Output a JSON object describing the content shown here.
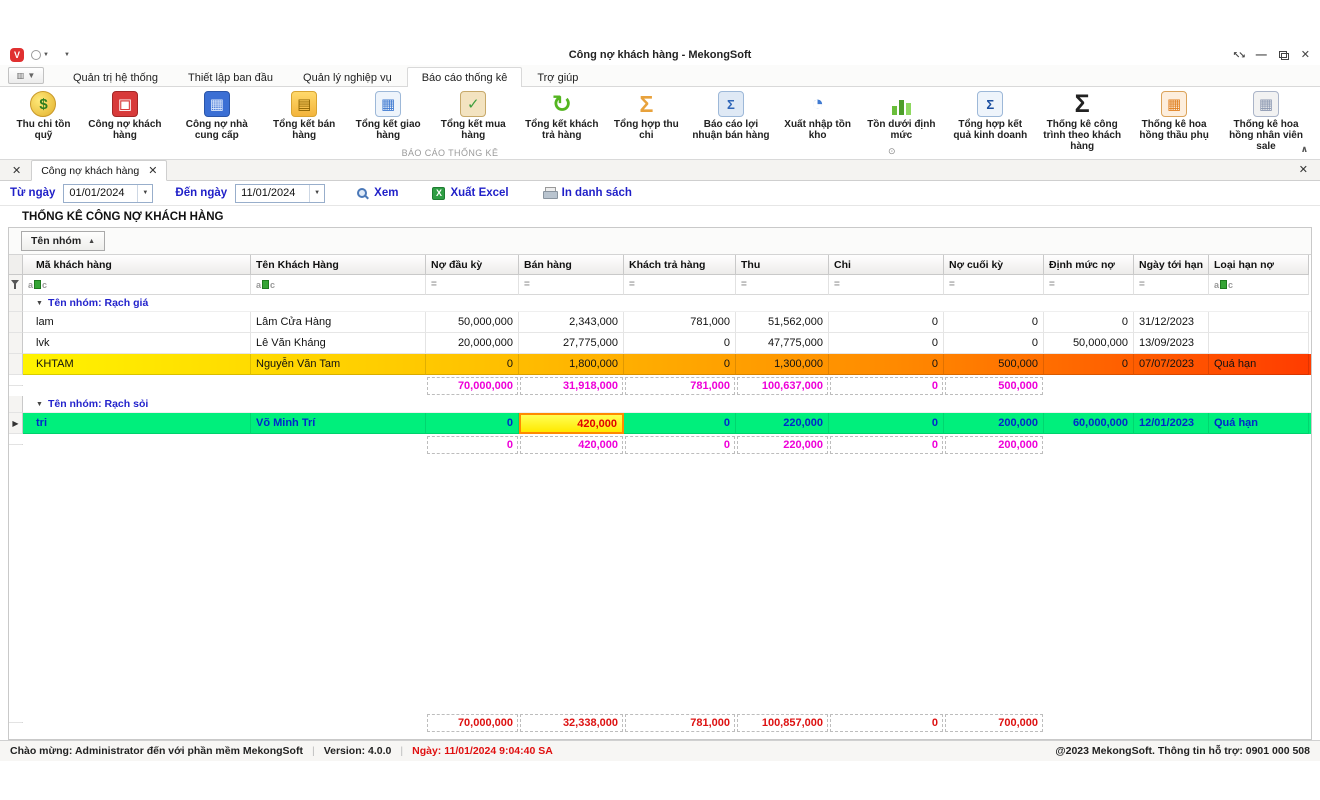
{
  "window": {
    "title": "Công nợ khách hàng - MekongSoft",
    "app_logo": "mekongsoft-logo-icon",
    "controls": [
      "expand-icon",
      "minimize-icon",
      "restore-icon",
      "close-icon"
    ]
  },
  "ribbon": {
    "tabs": [
      "Quản trị hệ thống",
      "Thiết lập ban đầu",
      "Quản lý nghiệp vụ",
      "Báo cáo thống kê",
      "Trợ giúp"
    ],
    "active_tab_index": 3,
    "group_label": "BÁO CÁO THỐNG KÊ",
    "buttons": [
      {
        "label": "Thu chi tồn quỹ",
        "icon": "coins-icon"
      },
      {
        "label": "Công nợ khách hàng",
        "icon": "customer-debt-icon"
      },
      {
        "label": "Công nợ nhà cung cấp",
        "icon": "supplier-debt-icon"
      },
      {
        "label": "Tổng kết bán hàng",
        "icon": "sales-note-icon"
      },
      {
        "label": "Tổng kết giao hàng",
        "icon": "delivery-table-icon"
      },
      {
        "label": "Tổng kết mua hàng",
        "icon": "purchase-clipboard-icon"
      },
      {
        "label": "Tổng kết khách trả hàng",
        "icon": "returns-refresh-icon"
      },
      {
        "label": "Tổng hợp thu chi",
        "icon": "sigma-orange-icon"
      },
      {
        "label": "Báo cáo lợi nhuận bán hàng",
        "icon": "profit-table-icon"
      },
      {
        "label": "Xuất nhập tồn kho",
        "icon": "inventory-gauge-icon"
      },
      {
        "label": "Tồn dưới định mức",
        "icon": "stock-bars-icon"
      },
      {
        "label": "Tổng hợp kết quả kinh doanh",
        "icon": "business-result-icon"
      },
      {
        "label": "Thống kê công trình theo khách hàng",
        "icon": "sigma-black-icon"
      },
      {
        "label": "Thống kê hoa hồng thầu phụ",
        "icon": "commission-table-icon"
      },
      {
        "label": "Thống kê hoa hồng nhân viên sale",
        "icon": "sales-grid-icon"
      }
    ]
  },
  "doc_tab": {
    "label": "Công nợ khách hàng"
  },
  "filter_bar": {
    "from_label": "Từ ngày",
    "from_value": "01/01/2024",
    "to_label": "Đến ngày",
    "to_value": "11/01/2024",
    "view_button": "Xem",
    "view_icon": "magnifier-icon",
    "excel_button": "Xuất Excel",
    "excel_icon": "excel-icon",
    "print_button": "In danh sách",
    "print_icon": "printer-icon"
  },
  "report_title": "THỐNG KÊ CÔNG NỢ KHÁCH HÀNG",
  "group_panel": {
    "label": "Tên nhóm",
    "sort": "ascending"
  },
  "grid": {
    "columns": [
      "Mã khách hàng",
      "Tên Khách Hàng",
      "Nợ đầu kỳ",
      "Bán hàng",
      "Khách trả hàng",
      "Thu",
      "Chi",
      "Nợ cuối kỳ",
      "Định mức nợ",
      "Ngày tới hạn",
      "Loại hạn nợ"
    ],
    "filter_icons": {
      "text": "auto-filter-abc-icon",
      "numeric": "equals-filter-icon",
      "row_header": "funnel-icon"
    },
    "groups": [
      {
        "name": "Tên nhóm: Rạch giá",
        "rows": [
          {
            "cells": [
              "lam",
              "Lâm Cửa Hàng",
              "50,000,000",
              "2,343,000",
              "781,000",
              "51,562,000",
              "0",
              "0",
              "0",
              "31/12/2023",
              ""
            ],
            "state": "normal"
          },
          {
            "cells": [
              "lvk",
              "Lê Văn Kháng",
              "20,000,000",
              "27,775,000",
              "0",
              "47,775,000",
              "0",
              "0",
              "50,000,000",
              "13/09/2023",
              ""
            ],
            "state": "normal"
          },
          {
            "cells": [
              "KHTAM",
              "Nguyễn Văn Tam",
              "0",
              "1,800,000",
              "0",
              "1,300,000",
              "0",
              "500,000",
              "0",
              "07/07/2023",
              "Quá hạn"
            ],
            "state": "overdue"
          }
        ],
        "totals": [
          "70,000,000",
          "31,918,000",
          "781,000",
          "100,637,000",
          "0",
          "500,000"
        ]
      },
      {
        "name": "Tên nhóm: Rạch sỏi",
        "rows": [
          {
            "cells": [
              "tri",
              "Võ Minh Trí",
              "0",
              "420,000",
              "0",
              "220,000",
              "0",
              "200,000",
              "60,000,000",
              "12/01/2023",
              "Quá hạn"
            ],
            "state": "selected",
            "focus_col": 3
          }
        ],
        "totals": [
          "0",
          "420,000",
          "0",
          "220,000",
          "0",
          "200,000"
        ]
      }
    ],
    "grand_totals": [
      "70,000,000",
      "32,338,000",
      "781,000",
      "100,857,000",
      "0",
      "700,000"
    ]
  },
  "status_bar": {
    "welcome": "Chào mừng: Administrator đến với phần mềm MekongSoft",
    "version": "Version: 4.0.0",
    "date": "Ngày: 11/01/2024 9:04:40 SA",
    "copyright": "@2023 MekongSoft. Thông tin hỗ trợ: 0901 000 508"
  },
  "colors": {
    "accent_blue": "#1f1fc8",
    "group_text": "#2323cc",
    "selected_row": "#00ef7c",
    "selected_text": "#0028cc",
    "overdue_start": "#fff500",
    "overdue_end": "#ff3c00",
    "focus_cell_bg": "#ffe900",
    "focus_cell_text": "#e00000",
    "group_total": "#ee00d8",
    "grand_total": "#dd1111"
  }
}
